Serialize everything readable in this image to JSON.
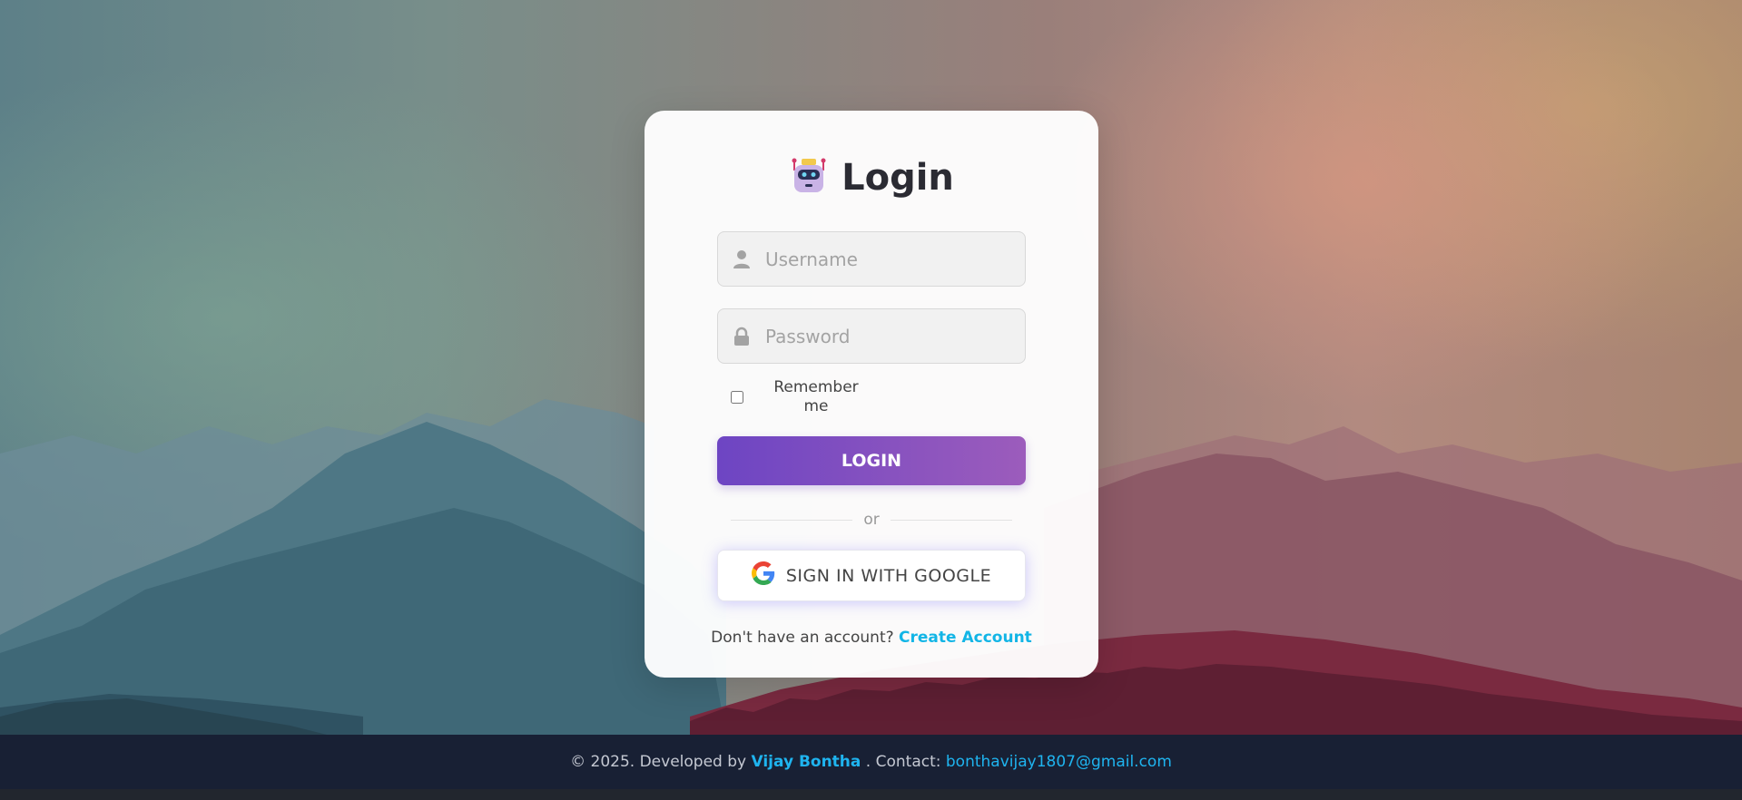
{
  "login": {
    "title": "Login",
    "username_placeholder": "Username",
    "password_placeholder": "Password",
    "remember_label": "Remember me",
    "login_button": "LOGIN",
    "divider_text": "or",
    "google_button": "SIGN IN WITH GOOGLE",
    "signup_prompt": "Don't have an account?",
    "signup_link": "Create Account"
  },
  "icons": {
    "title_icon": "robot-icon",
    "username_icon": "user-icon",
    "password_icon": "lock-icon",
    "google_icon": "google-icon"
  },
  "footer": {
    "prefix": "© 2025. Developed by",
    "author": "Vijay Bontha",
    "contact_label": ". Contact:",
    "email": "bonthavijay1807@gmail.com"
  },
  "colors": {
    "accent_start": "#6d45c3",
    "accent_end": "#9c5cbc",
    "link": "#12b5e6",
    "footer_bg": "#182034"
  }
}
